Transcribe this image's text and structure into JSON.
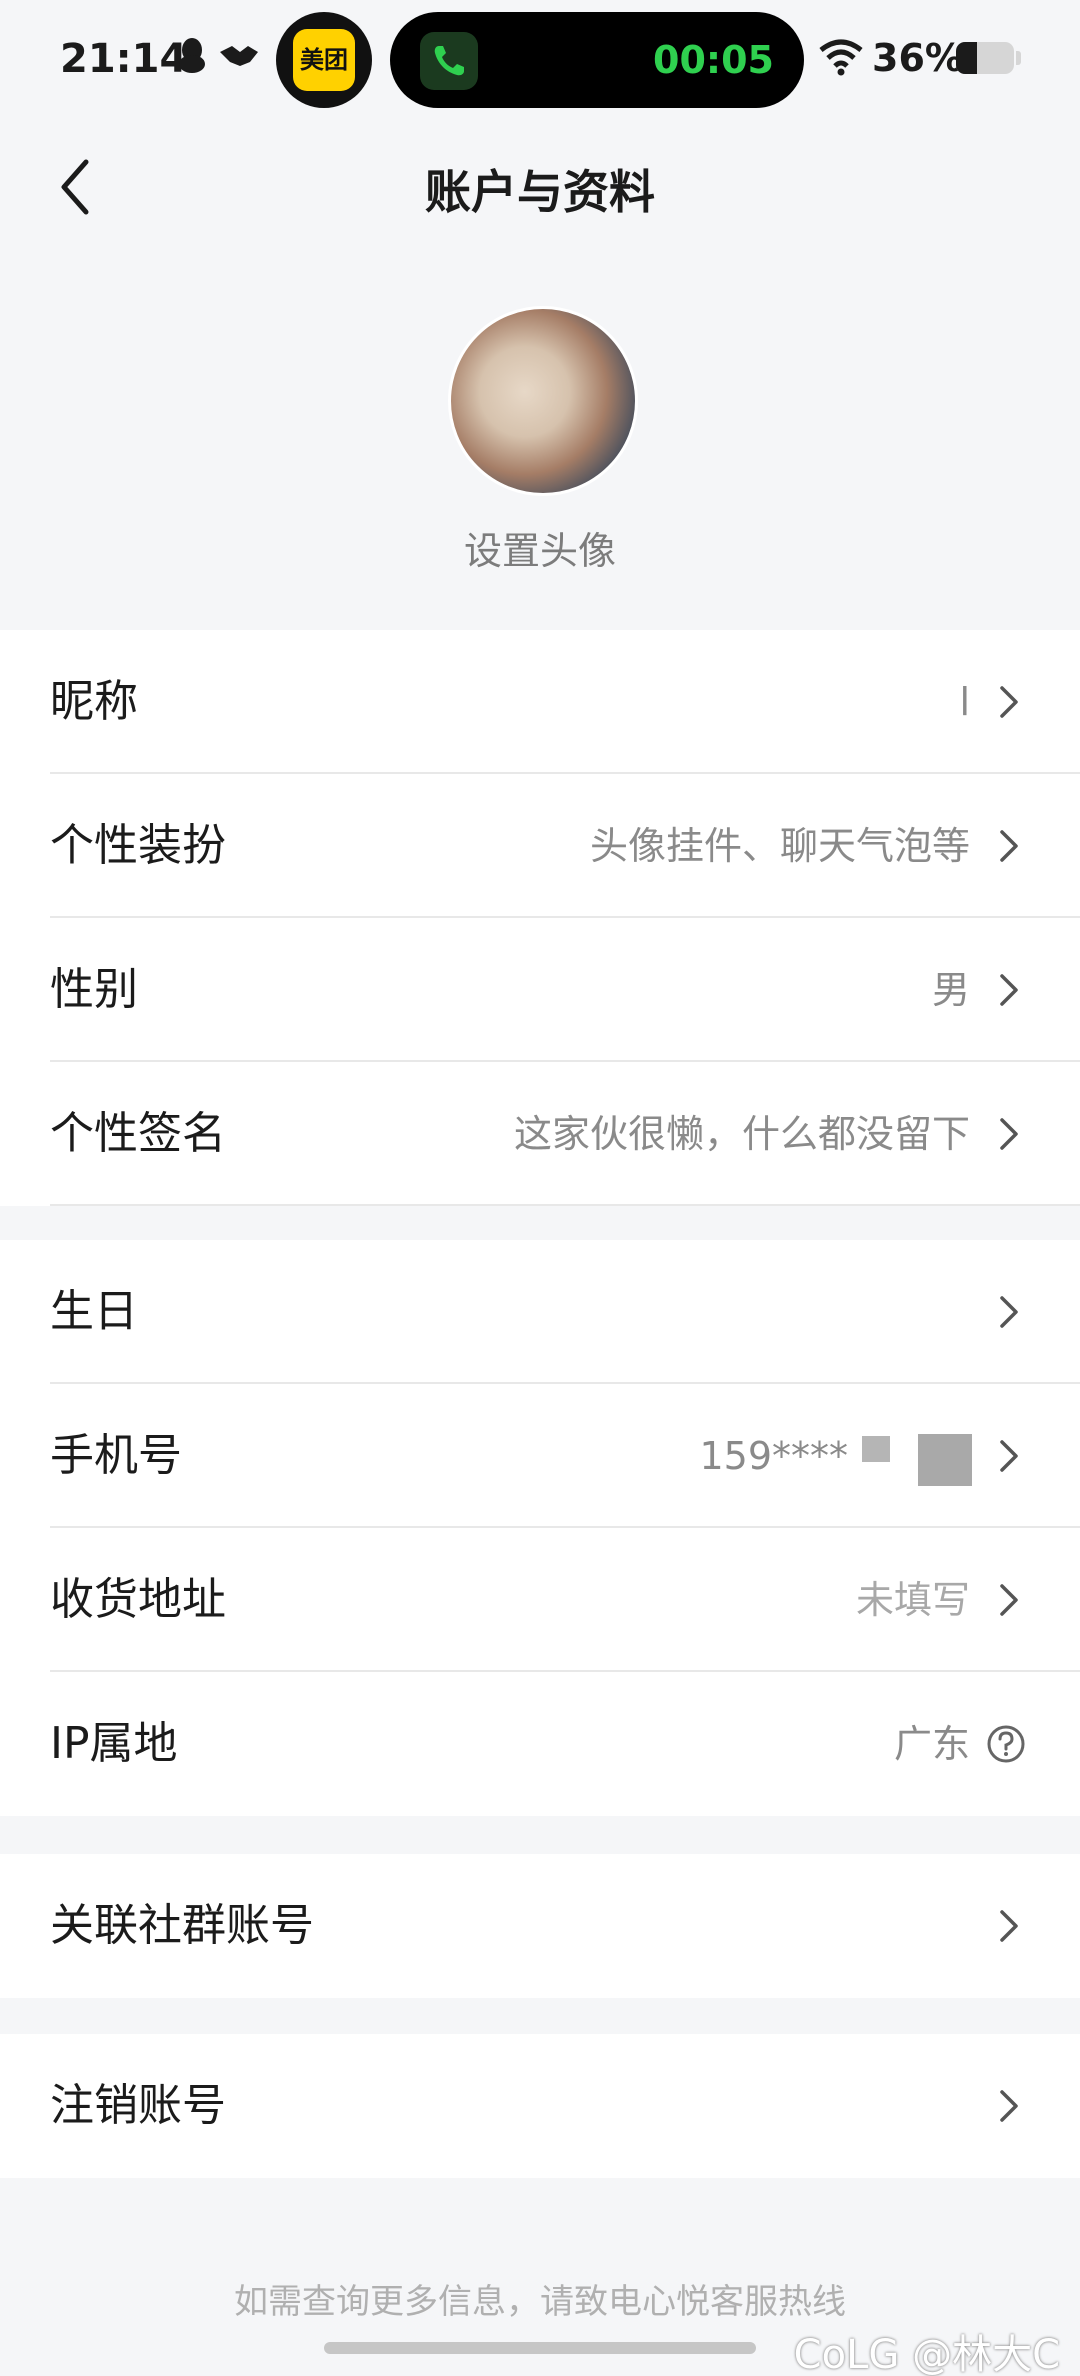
{
  "status_bar": {
    "time": "21:14",
    "meituan_label": "美团",
    "call_timer": "00:05",
    "battery_percent": "36%",
    "battery_level": 0.36
  },
  "nav": {
    "title": "账户与资料"
  },
  "avatar": {
    "label": "设置头像"
  },
  "profile": {
    "nickname": {
      "label": "昵称",
      "value": "l"
    },
    "personalize": {
      "label": "个性装扮",
      "value": "头像挂件、聊天气泡等"
    },
    "gender": {
      "label": "性别",
      "value": "男"
    },
    "signature": {
      "label": "个性签名",
      "value": "这家伙很懒，什么都没留下"
    }
  },
  "account": {
    "birthday": {
      "label": "生日",
      "value": ""
    },
    "phone": {
      "label": "手机号",
      "value": "159****"
    },
    "address": {
      "label": "收货地址",
      "value": "未填写"
    },
    "ip": {
      "label": "IP属地",
      "value": "广东"
    }
  },
  "links": {
    "community": {
      "label": "关联社群账号"
    },
    "delete": {
      "label": "注销账号"
    }
  },
  "footer": {
    "note": "如需查询更多信息，请致电心悦客服热线",
    "watermark": "CoLG @林大C"
  }
}
